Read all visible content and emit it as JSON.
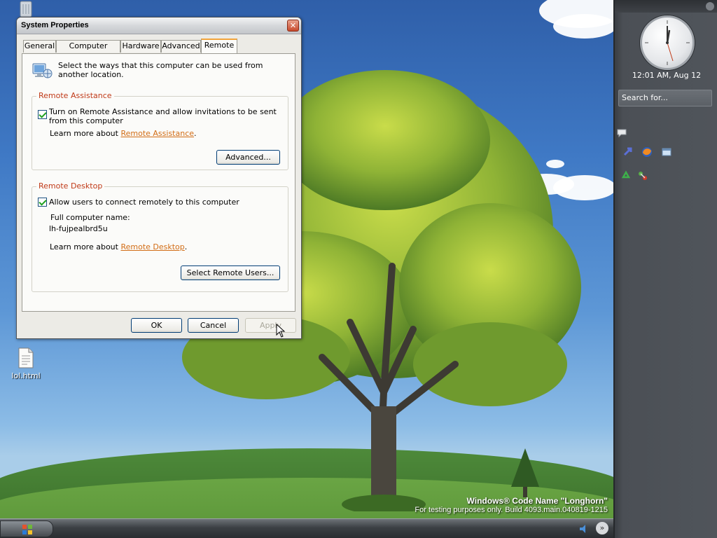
{
  "dialog": {
    "title": "System Properties",
    "tabs": [
      {
        "label": "General",
        "active": false
      },
      {
        "label": "Computer Name",
        "active": false
      },
      {
        "label": "Hardware",
        "active": false
      },
      {
        "label": "Advanced",
        "active": false
      },
      {
        "label": "Remote",
        "active": true
      }
    ],
    "intro": "Select the ways that this computer can be used from another location.",
    "remote_assistance": {
      "title": "Remote Assistance",
      "checkbox_label": "Turn on Remote Assistance and allow invitations to be sent from this computer",
      "checked": true,
      "learn_more_prefix": "Learn more about",
      "learn_more_link": "Remote Assistance",
      "learn_more_suffix": ".",
      "advanced_button": "Advanced..."
    },
    "remote_desktop": {
      "title": "Remote Desktop",
      "checkbox_label": "Allow users to connect remotely to this computer",
      "checked": true,
      "full_name_label": "Full computer name:",
      "full_name_value": "lh-fujpealbrd5u",
      "learn_more_prefix": "Learn more about",
      "learn_more_link": "Remote Desktop",
      "learn_more_suffix": ".",
      "select_users_button": "Select Remote Users..."
    },
    "buttons": {
      "ok": "OK",
      "cancel": "Cancel",
      "apply": "Apply"
    },
    "close_glyph": "✕"
  },
  "desktop": {
    "icons": [
      {
        "label": "lol.html",
        "icon": "html-file-icon"
      }
    ],
    "watermark": {
      "line1": "Windows® Code Name \"Longhorn\"",
      "line2": "For testing purposes only. Build 4093.main.040819-1215"
    }
  },
  "sidebar": {
    "clock_time": "12:01 AM, Aug 12",
    "search_placeholder": "Search for..."
  },
  "taskbar": {
    "tray_chevron": "»"
  },
  "colors": {
    "group_title": "#c03a18",
    "link": "#d26d16",
    "active_tab_accent": "#f2a43a",
    "sidebar_bg": "#4b4f55"
  }
}
